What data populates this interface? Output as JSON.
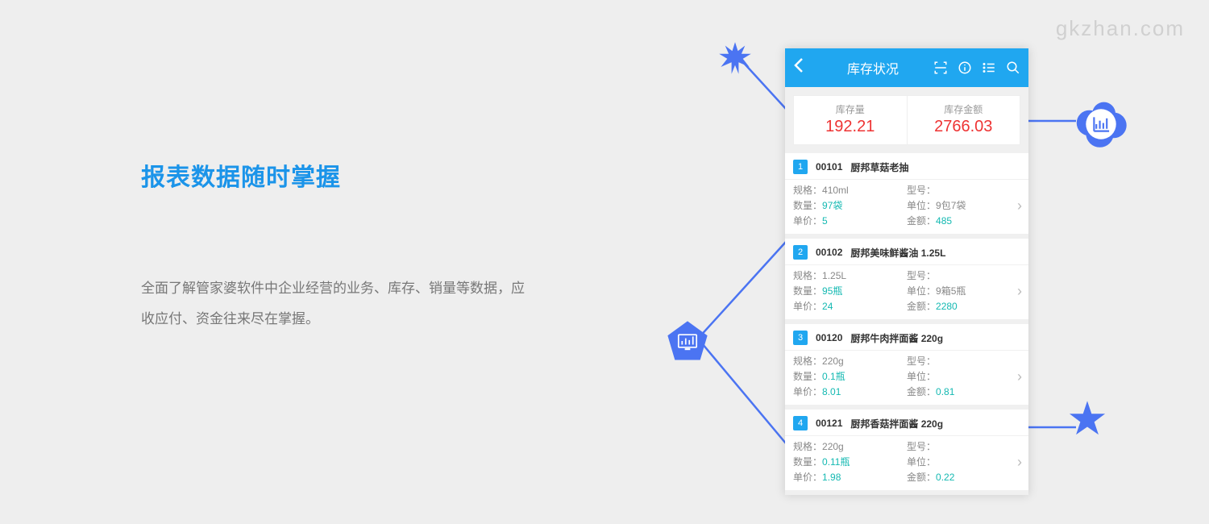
{
  "watermark": "gkzhan.com",
  "marketing": {
    "headline": "报表数据随时掌握",
    "body": "全面了解管家婆软件中企业经营的业务、库存、销量等数据，应收应付、资金往来尽在掌握。"
  },
  "app": {
    "title": "库存状况",
    "icons": [
      "scan-icon",
      "info-icon",
      "list-icon",
      "search-icon"
    ]
  },
  "summary": {
    "qty_label": "库存量",
    "qty_value": "192.21",
    "amt_label": "库存金额",
    "amt_value": "2766.03"
  },
  "labels": {
    "spec": "规格：",
    "model": "型号：",
    "qty": "数量：",
    "unit": "单位：",
    "price": "单价：",
    "amount": "金额："
  },
  "items": [
    {
      "idx": "1",
      "code": "00101",
      "name": "厨邦草菇老抽",
      "spec": "410ml",
      "model": "",
      "qty": "97袋",
      "unit": "9包7袋",
      "price": "5",
      "amount": "485"
    },
    {
      "idx": "2",
      "code": "00102",
      "name": "厨邦美味鲜酱油 1.25L",
      "spec": "1.25L",
      "model": "",
      "qty": "95瓶",
      "unit": "9箱5瓶",
      "price": "24",
      "amount": "2280"
    },
    {
      "idx": "3",
      "code": "00120",
      "name": "厨邦牛肉拌面酱 220g",
      "spec": "220g",
      "model": "",
      "qty": "0.1瓶",
      "unit": "",
      "price": "8.01",
      "amount": "0.81"
    },
    {
      "idx": "4",
      "code": "00121",
      "name": "厨邦香菇拌面酱 220g",
      "spec": "220g",
      "model": "",
      "qty": "0.11瓶",
      "unit": "",
      "price": "1.98",
      "amount": "0.22"
    }
  ]
}
